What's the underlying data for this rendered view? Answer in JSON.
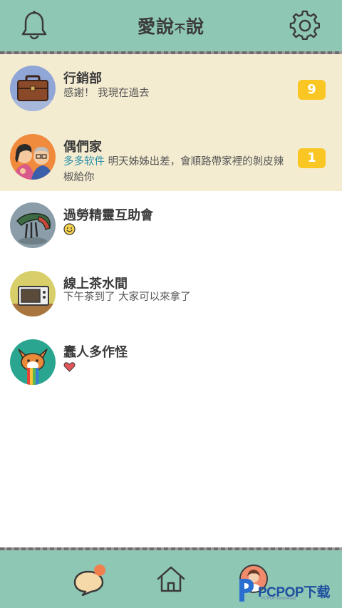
{
  "header": {
    "logo_main": "愛說",
    "logo_small": "不",
    "logo_end": "說"
  },
  "chats": [
    {
      "name": "行銷部",
      "message": "感謝！ 我現在過去",
      "badge": "9"
    },
    {
      "name": "偶們家",
      "sender": "多多软件",
      "message_line1": " 明天姊姊出差，會順路帶家裡的剝皮辣",
      "message_line2": "椒給你",
      "badge": "1"
    },
    {
      "name": "過勞精靈互助會",
      "emoji": "smile-emoji"
    },
    {
      "name": "線上茶水間",
      "message": "下午茶到了 大家可以來拿了"
    },
    {
      "name": "蠢人多作怪",
      "emoji": "heart-emoji"
    }
  ],
  "watermark": {
    "text": "PCPOP下载",
    "sub": "PCPOP Download"
  },
  "colors": {
    "bar": "#8fc7b5",
    "unread_bg": "#f4ecd1",
    "badge": "#f9c623",
    "sender": "#2a8fa8",
    "notify_dot": "#f07f4e"
  }
}
